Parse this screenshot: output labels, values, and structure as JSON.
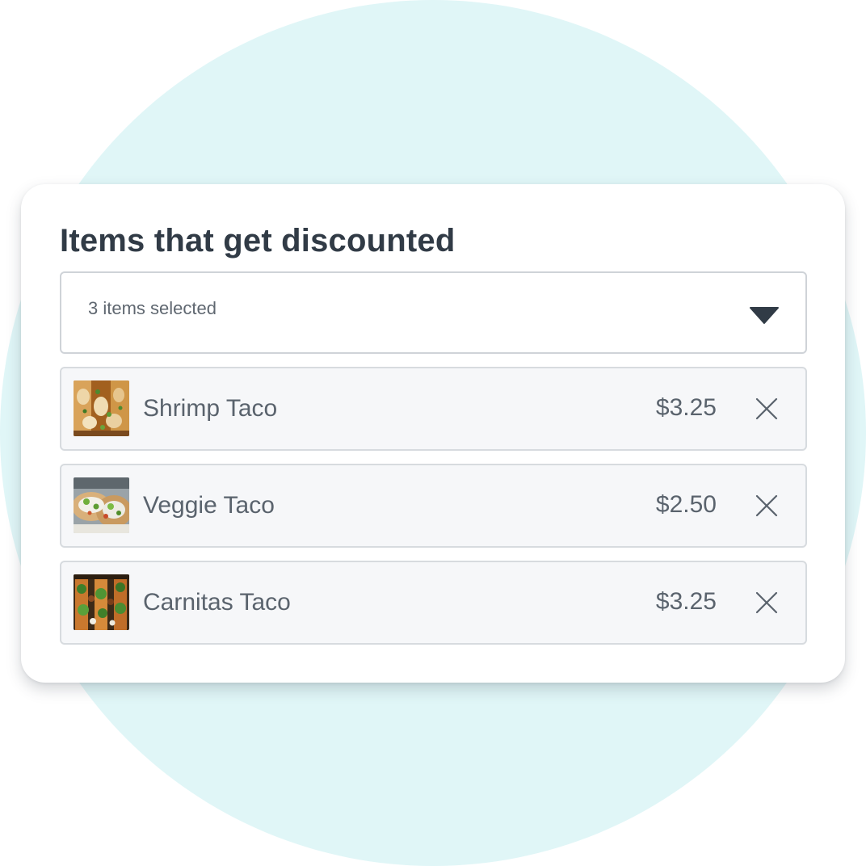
{
  "widget": {
    "title": "Items that get discounted"
  },
  "dropdown": {
    "value": "3 items selected",
    "icon": "caret-down-icon"
  },
  "items": [
    {
      "name": "Shrimp Taco",
      "price": "$3.25",
      "thumbnail": "shrimp-taco-image",
      "remove_icon": "close-icon"
    },
    {
      "name": "Veggie Taco",
      "price": "$2.50",
      "thumbnail": "veggie-taco-image",
      "remove_icon": "close-icon"
    },
    {
      "name": "Carnitas Taco",
      "price": "$3.25",
      "thumbnail": "carnitas-taco-image",
      "remove_icon": "close-icon"
    }
  ],
  "colors": {
    "background_circle": "#e0f6f7",
    "card": "#ffffff",
    "title_text": "#313b46",
    "body_text": "#5a636d",
    "row_background": "#f6f7f9",
    "border": "#cfd3d8",
    "caret": "#313b46"
  }
}
